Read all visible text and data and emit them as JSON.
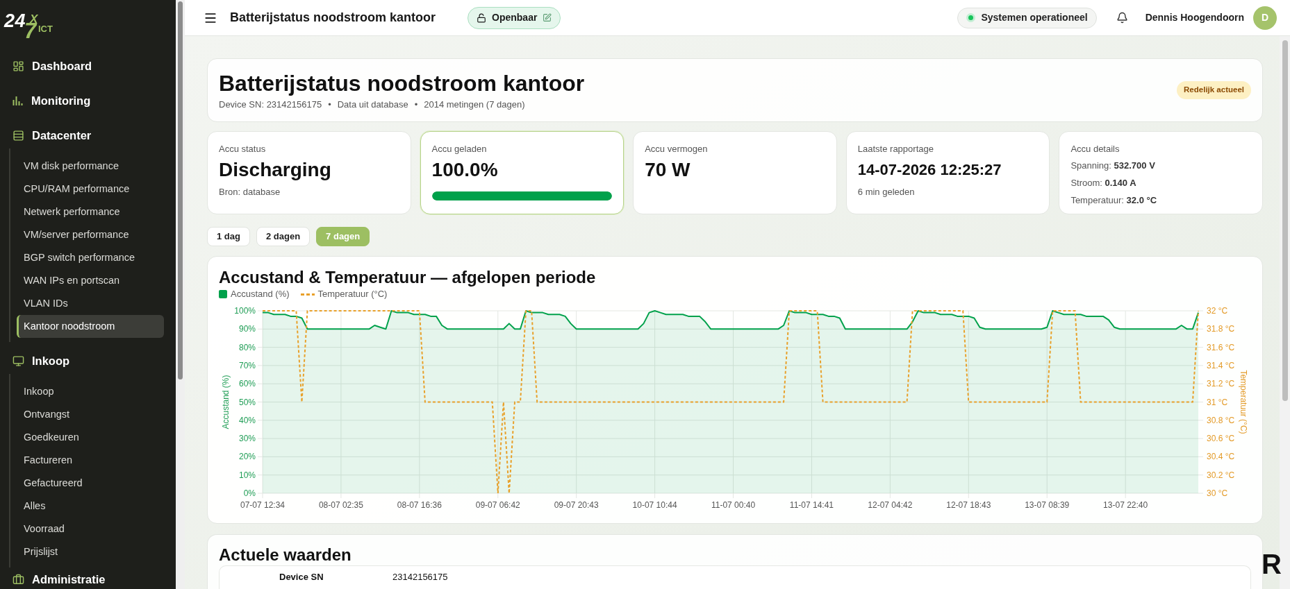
{
  "sidebar": {
    "logo": {
      "digits": "24",
      "x": "X",
      "seven": "7",
      "suffix": "ICT"
    },
    "sections": [
      {
        "kind": "dashboard",
        "label": "Dashboard"
      },
      {
        "kind": "monitoring",
        "label": "Monitoring"
      },
      {
        "kind": "datacenter",
        "label": "Datacenter",
        "children": [
          {
            "label": "VM disk performance",
            "selected": false
          },
          {
            "label": "CPU/RAM performance",
            "selected": false
          },
          {
            "label": "Netwerk performance",
            "selected": false
          },
          {
            "label": "VM/server performance",
            "selected": false
          },
          {
            "label": "BGP switch performance",
            "selected": false
          },
          {
            "label": "WAN IPs en portscan",
            "selected": false
          },
          {
            "label": "VLAN IDs",
            "selected": false
          },
          {
            "label": "Kantoor noodstroom",
            "selected": true
          }
        ]
      },
      {
        "kind": "purchasing",
        "label": "Inkoop",
        "children": [
          {
            "label": "Inkoop",
            "selected": false
          },
          {
            "label": "Ontvangst",
            "selected": false
          },
          {
            "label": "Goedkeuren",
            "selected": false
          },
          {
            "label": "Factureren",
            "selected": false
          },
          {
            "label": "Gefactureerd",
            "selected": false
          },
          {
            "label": "Alles",
            "selected": false
          },
          {
            "label": "Voorraad",
            "selected": false
          },
          {
            "label": "Prijslijst",
            "selected": false
          }
        ]
      },
      {
        "kind": "administration",
        "label": "Administratie"
      }
    ]
  },
  "header": {
    "title": "Batterijstatus noodstroom kantoor",
    "visibility": "Openbaar",
    "status": "Systemen operationeel",
    "user": {
      "name": "Dennis Hoogendoorn",
      "initial": "D"
    }
  },
  "title_card": {
    "title": "Batterijstatus noodstroom kantoor",
    "meta": [
      "Device SN: 23142156175",
      "•",
      "Data uit database",
      "•",
      "2014 metingen (7 dagen)"
    ],
    "freshness": "Redelijk actueel"
  },
  "stats": [
    {
      "kind": "status",
      "label": "Accu status",
      "value": "Discharging",
      "note": "Bron: database",
      "highlighted": false
    },
    {
      "kind": "progress",
      "label": "Accu geladen",
      "value": "100.0%",
      "level": 1,
      "highlighted": true
    },
    {
      "kind": "plain",
      "label": "Accu vermogen",
      "value": "70 W",
      "highlighted": false
    },
    {
      "kind": "timestamp",
      "label": "Laatste rapportage",
      "value": "14-07-2026 12:25:27",
      "note": "6 min geleden",
      "highlighted": false
    },
    {
      "kind": "details",
      "label": "Accu details",
      "lines": [
        "Spanning: **532.700 V**",
        "Stroom: **0.140 A**",
        "Temperatuur: **32.0 °C**"
      ],
      "highlighted": false
    }
  ],
  "range_buttons": [
    {
      "label": "1 dag",
      "selected": false
    },
    {
      "label": "2 dagen",
      "selected": false
    },
    {
      "label": "7 dagen",
      "selected": true
    }
  ],
  "chart": {
    "chart_data": {
      "type": "line",
      "title": "Accustand & Temperatuur — afgelopen periode",
      "ylabel": "Accustand (%)",
      "y2label": "Temperatuur (°C)",
      "ylim": [
        0,
        100
      ],
      "y2lim": [
        30,
        32
      ],
      "grid": true,
      "legend": "top",
      "categories": [
        "07-07 12:34",
        null,
        null,
        null,
        null,
        null,
        null,
        null,
        null,
        null,
        null,
        null,
        null,
        null,
        "08-07 02:35",
        null,
        null,
        null,
        null,
        null,
        null,
        null,
        null,
        null,
        null,
        null,
        null,
        null,
        "08-07 16:36",
        null,
        null,
        null,
        null,
        null,
        null,
        null,
        null,
        null,
        null,
        null,
        null,
        null,
        "09-07 06:42",
        null,
        null,
        null,
        null,
        null,
        null,
        null,
        null,
        null,
        null,
        null,
        null,
        null,
        "09-07 20:43",
        null,
        null,
        null,
        null,
        null,
        null,
        null,
        null,
        null,
        null,
        null,
        null,
        null,
        "10-07 10:44",
        null,
        null,
        null,
        null,
        null,
        null,
        null,
        null,
        null,
        null,
        null,
        null,
        null,
        "11-07 00:40",
        null,
        null,
        null,
        null,
        null,
        null,
        null,
        null,
        null,
        null,
        null,
        null,
        null,
        "11-07 14:41",
        null,
        null,
        null,
        null,
        null,
        null,
        null,
        null,
        null,
        null,
        null,
        null,
        null,
        "12-07 04:42",
        null,
        null,
        null,
        null,
        null,
        null,
        null,
        null,
        null,
        null,
        null,
        null,
        null,
        "12-07 18:43",
        null,
        null,
        null,
        null,
        null,
        null,
        null,
        null,
        null,
        null,
        null,
        null,
        null,
        "13-07 08:39",
        null,
        null,
        null,
        null,
        null,
        null,
        null,
        null,
        null,
        null,
        null,
        null,
        null,
        "13-07 22:40",
        null,
        null,
        null,
        null,
        null,
        null,
        null,
        null,
        null,
        null,
        null,
        null,
        null
      ],
      "yticks": [
        {
          "value": 0,
          "label": "0%"
        },
        {
          "value": 10,
          "label": "10%"
        },
        {
          "value": 20,
          "label": "20%"
        },
        {
          "value": 30,
          "label": "30%"
        },
        {
          "value": 40,
          "label": "40%"
        },
        {
          "value": 50,
          "label": "50%"
        },
        {
          "value": 60,
          "label": "60%"
        },
        {
          "value": 70,
          "label": "70%"
        },
        {
          "value": 80,
          "label": "80%"
        },
        {
          "value": 90,
          "label": "90%"
        },
        {
          "value": 100,
          "label": "100%"
        }
      ],
      "y2ticks": [
        {
          "value": 30,
          "label": "30 °C"
        },
        {
          "value": 30.2,
          "label": "30.2 °C"
        },
        {
          "value": 30.4,
          "label": "30.4 °C"
        },
        {
          "value": 30.6,
          "label": "30.6 °C"
        },
        {
          "value": 30.8,
          "label": "30.8 °C"
        },
        {
          "value": 31,
          "label": "31 °C"
        },
        {
          "value": 31.2,
          "label": "31.2 °C"
        },
        {
          "value": 31.4,
          "label": "31.4 °C"
        },
        {
          "value": 31.6,
          "label": "31.6 °C"
        },
        {
          "value": 31.8,
          "label": "31.8 °C"
        },
        {
          "value": 32,
          "label": "32 °C"
        }
      ],
      "series": [
        {
          "name": "Accustand (%)",
          "color": "#00a14b",
          "values": [
            99,
            99,
            98,
            98,
            98,
            97,
            97,
            96,
            90,
            90,
            90,
            90,
            90,
            90,
            90,
            90,
            90,
            90,
            90,
            90,
            92,
            91,
            90,
            100,
            99,
            99,
            99,
            98,
            98,
            98,
            97,
            97,
            92,
            90,
            90,
            90,
            90,
            90,
            90,
            90,
            90,
            90,
            90,
            90,
            93,
            90,
            90,
            100,
            99,
            99,
            99,
            98,
            98,
            98,
            97,
            93,
            90,
            90,
            90,
            90,
            90,
            90,
            90,
            90,
            90,
            90,
            90,
            90,
            93,
            99,
            100,
            99,
            98,
            98,
            98,
            98,
            97,
            97,
            97,
            94,
            90,
            90,
            90,
            90,
            90,
            90,
            90,
            90,
            90,
            90,
            90,
            90,
            90,
            92,
            100,
            99,
            99,
            99,
            98,
            98,
            98,
            97,
            97,
            96,
            90,
            90,
            90,
            90,
            90,
            90,
            90,
            90,
            90,
            90,
            90,
            90,
            94,
            100,
            99,
            99,
            99,
            98,
            98,
            98,
            97,
            97,
            97,
            96,
            91,
            90,
            90,
            90,
            90,
            90,
            90,
            90,
            90,
            90,
            90,
            90,
            91,
            100,
            99,
            98,
            98,
            98,
            98,
            97,
            97,
            97,
            97,
            95,
            91,
            90,
            90,
            90,
            90,
            90,
            90,
            90,
            90,
            90,
            90,
            90,
            92,
            90,
            90,
            99
          ]
        },
        {
          "name": "Temperatuur (°C)",
          "color": "#e8a02a",
          "axis": "y2",
          "line_style": "dashed",
          "values": [
            32,
            32,
            32,
            32,
            32,
            32,
            32,
            31,
            32,
            32,
            32,
            32,
            32,
            32,
            32,
            32,
            32,
            32,
            32,
            32,
            32,
            32,
            32,
            32,
            32,
            32,
            32,
            32,
            32,
            31,
            31,
            31,
            31,
            31,
            31,
            31,
            31,
            31,
            31,
            31,
            31,
            31,
            30,
            31,
            30,
            31,
            31,
            32,
            32,
            31,
            31,
            31,
            31,
            31,
            31,
            31,
            31,
            31,
            31,
            31,
            31,
            31,
            31,
            31,
            31,
            31,
            31,
            31,
            31,
            31,
            31,
            31,
            31,
            31,
            31,
            31,
            31,
            31,
            31,
            31,
            31,
            31,
            31,
            31,
            31,
            31,
            31,
            31,
            31,
            31,
            31,
            31,
            31,
            31,
            32,
            32,
            32,
            32,
            32,
            32,
            31,
            31,
            31,
            31,
            31,
            31,
            31,
            31,
            31,
            31,
            31,
            31,
            31,
            31,
            31,
            31,
            32,
            32,
            32,
            32,
            32,
            32,
            32,
            32,
            32,
            32,
            31,
            31,
            31,
            31,
            31,
            31,
            31,
            31,
            31,
            31,
            31,
            31,
            31,
            31,
            31,
            32,
            32,
            32,
            32,
            32,
            31,
            31,
            31,
            31,
            31,
            31,
            31,
            31,
            31,
            31,
            31,
            31,
            31,
            31,
            31,
            31,
            31,
            31,
            31,
            31,
            31,
            32
          ]
        }
      ]
    }
  },
  "current_values": {
    "title": "Actuele waarden",
    "rows": [
      {
        "label": "Device SN",
        "value": "23142156175"
      }
    ]
  },
  "edge_text": "R"
}
